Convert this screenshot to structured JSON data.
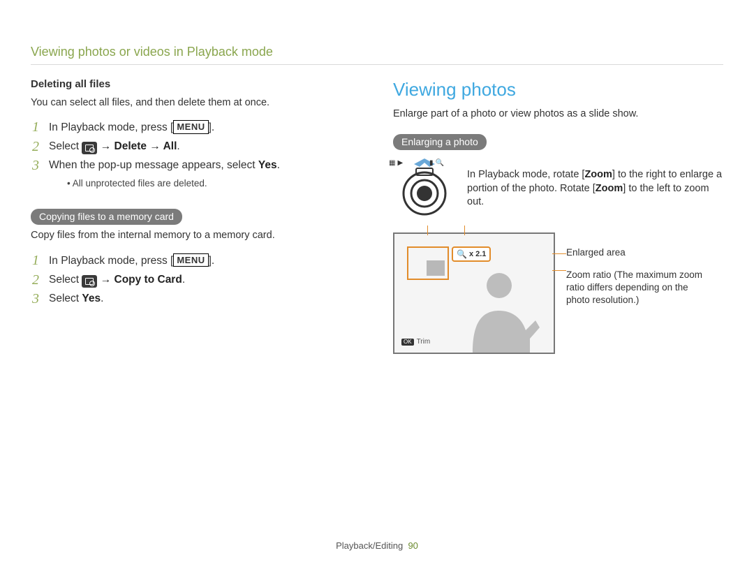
{
  "header": {
    "section_title": "Viewing photos or videos in Playback mode"
  },
  "left": {
    "delete_heading": "Deleting all files",
    "delete_intro": "You can select all files, and then delete them at once.",
    "delete_steps": {
      "s1_a": "In Playback mode, press [",
      "s1_menu": "MENU",
      "s1_b": "].",
      "s2_a": "Select ",
      "s2_b": " → Delete → All",
      "s2_c": ".",
      "s3_a": "When the pop-up message appears, select ",
      "s3_b": "Yes",
      "s3_c": ".",
      "note": "All unprotected files are deleted."
    },
    "copy_pill": "Copying files to a memory card",
    "copy_intro": "Copy files from the internal memory to a memory card.",
    "copy_steps": {
      "s1_a": "In Playback mode, press [",
      "s1_menu": "MENU",
      "s1_b": "].",
      "s2_a": "Select ",
      "s2_b": " → Copy to Card",
      "s2_c": ".",
      "s3_a": "Select ",
      "s3_b": "Yes",
      "s3_c": "."
    }
  },
  "right": {
    "title": "Viewing photos",
    "intro": "Enlarge part of a photo or view photos as a slide show.",
    "enlarge_pill": "Enlarging a photo",
    "zoom_text_a": "In Playback mode, rotate [",
    "zoom_text_b": "Zoom",
    "zoom_text_c": "] to the right to enlarge a portion of the photo. Rotate [",
    "zoom_text_d": "Zoom",
    "zoom_text_e": "] to the left to zoom out.",
    "label_enlarged": "Enlarged area",
    "label_zoomratio": "Zoom ratio (The maximum zoom ratio differs depending on the photo resolution.)",
    "zoom_badge": "x 2.1",
    "trim_ok": "OK",
    "trim_label": "Trim",
    "wheel_icons": {
      "thumb": "▦",
      "play": "▶",
      "battery": "▮",
      "mag": "🔍"
    }
  },
  "footer": {
    "chapter": "Playback/Editing",
    "page": "90"
  }
}
